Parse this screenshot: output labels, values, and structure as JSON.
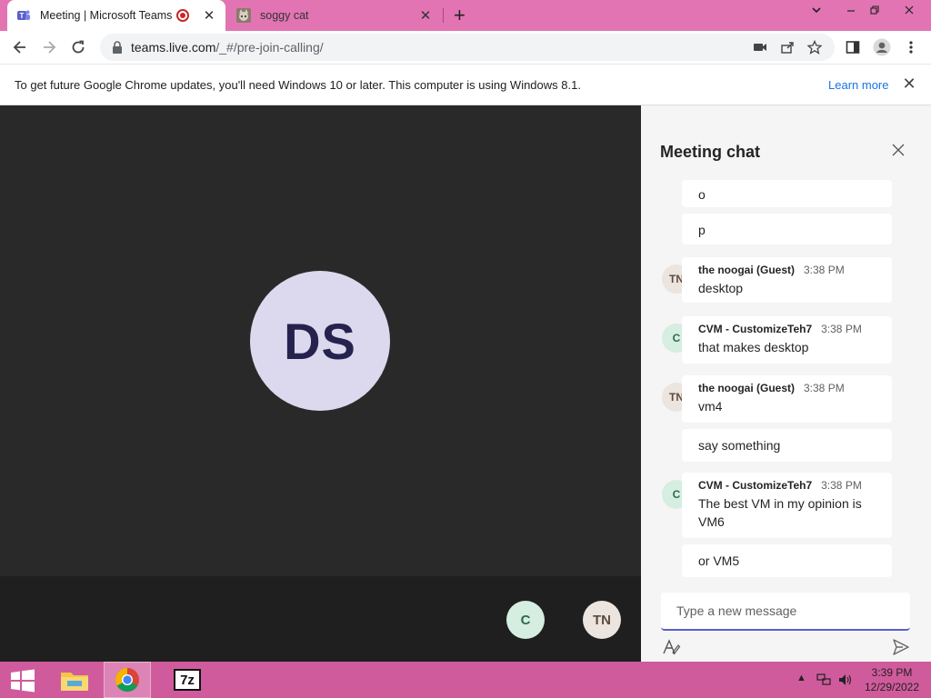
{
  "browser": {
    "tabs": [
      {
        "title": "Meeting | Microsoft Teams",
        "active": true,
        "recording": true
      },
      {
        "title": "soggy cat",
        "active": false
      }
    ],
    "url_host": "teams.live.com",
    "url_path": "/_#/pre-join-calling/",
    "infobar": {
      "message": "To get future Google Chrome updates, you'll need Windows 10 or later. This computer is using Windows 8.1.",
      "link": "Learn more"
    }
  },
  "stage": {
    "main_participant_initials": "DS",
    "participants": [
      {
        "initials": "C"
      },
      {
        "initials": "TN"
      }
    ]
  },
  "chat": {
    "title": "Meeting chat",
    "messages": [
      {
        "text": "o"
      },
      {
        "text": "p"
      },
      {
        "avatar": "TN",
        "name": "the noogai (Guest)",
        "time": "3:38 PM",
        "text": "desktop"
      },
      {
        "avatar": "C",
        "name": "CVM - CustomizeTeh7",
        "time": "3:38 PM",
        "text": "that makes desktop"
      },
      {
        "avatar": "TN",
        "name": "the noogai (Guest)",
        "time": "3:38 PM",
        "text": "vm4"
      },
      {
        "text": "say something"
      },
      {
        "avatar": "C",
        "name": "CVM - CustomizeTeh7",
        "time": "3:38 PM",
        "text": "The best VM in my opinion is VM6"
      },
      {
        "text": "or VM5"
      }
    ],
    "compose_placeholder": "Type a new message"
  },
  "taskbar": {
    "apps": [
      "file-explorer",
      "chrome",
      "7-zip"
    ],
    "seven_zip_label": "7z",
    "clock_time": "3:39 PM",
    "clock_date": "12/29/2022"
  },
  "colors": {
    "tabstrip": "#e274b3",
    "taskbar": "#d05b9c",
    "stage": "#292929",
    "teams_accent": "#5b5fc7"
  }
}
